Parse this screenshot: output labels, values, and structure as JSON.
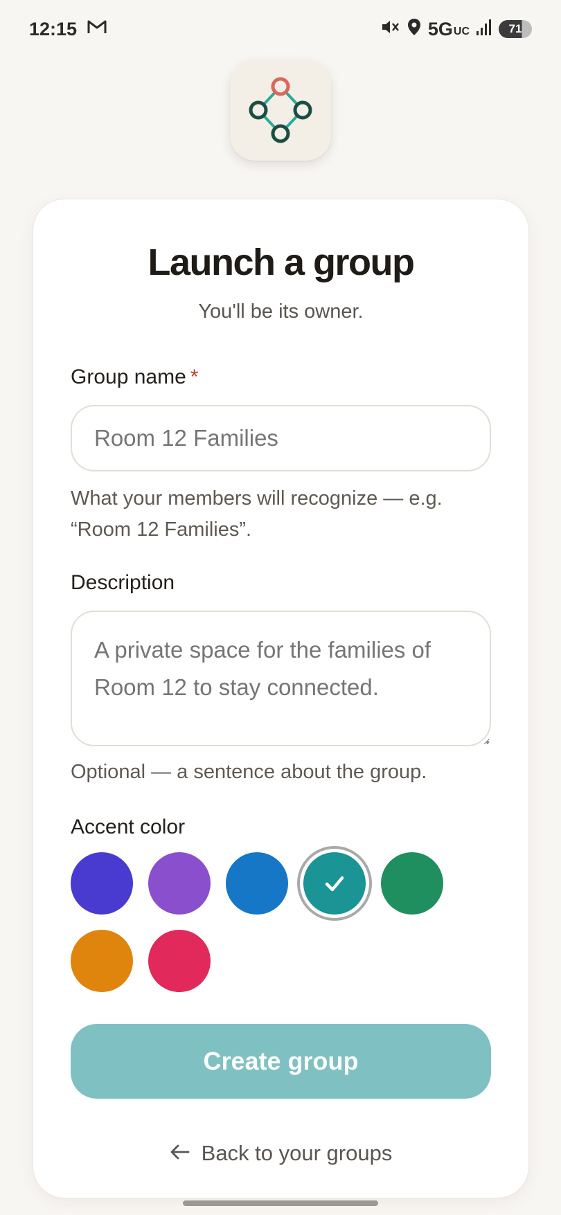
{
  "status_bar": {
    "time": "12:15",
    "network": "5G",
    "network_sub": "UC",
    "battery": "71"
  },
  "app": {
    "logo_colors": {
      "top_node": "#d9675b",
      "nodes": "#1b4d43",
      "edges": "#2aa99a"
    }
  },
  "form": {
    "title": "Launch a group",
    "subtitle": "You'll be its owner.",
    "group_name": {
      "label": "Group name",
      "required_mark": "*",
      "value": "",
      "placeholder": "Room 12 Families",
      "help": "What your members will recognize — e.g. “Room 12 Families”."
    },
    "description": {
      "label": "Description",
      "value": "",
      "placeholder": "A private space for the families of Room 12 to stay connected.",
      "help": "Optional — a sentence about the group."
    },
    "accent_color": {
      "label": "Accent color",
      "options": [
        "#4a3bd0",
        "#8a4fcc",
        "#1577c6",
        "#1a9494",
        "#1f8f5f",
        "#df850e",
        "#e1295b"
      ],
      "selected": "#1a9494"
    },
    "submit_label": "Create group",
    "back_label": "Back to your groups"
  }
}
